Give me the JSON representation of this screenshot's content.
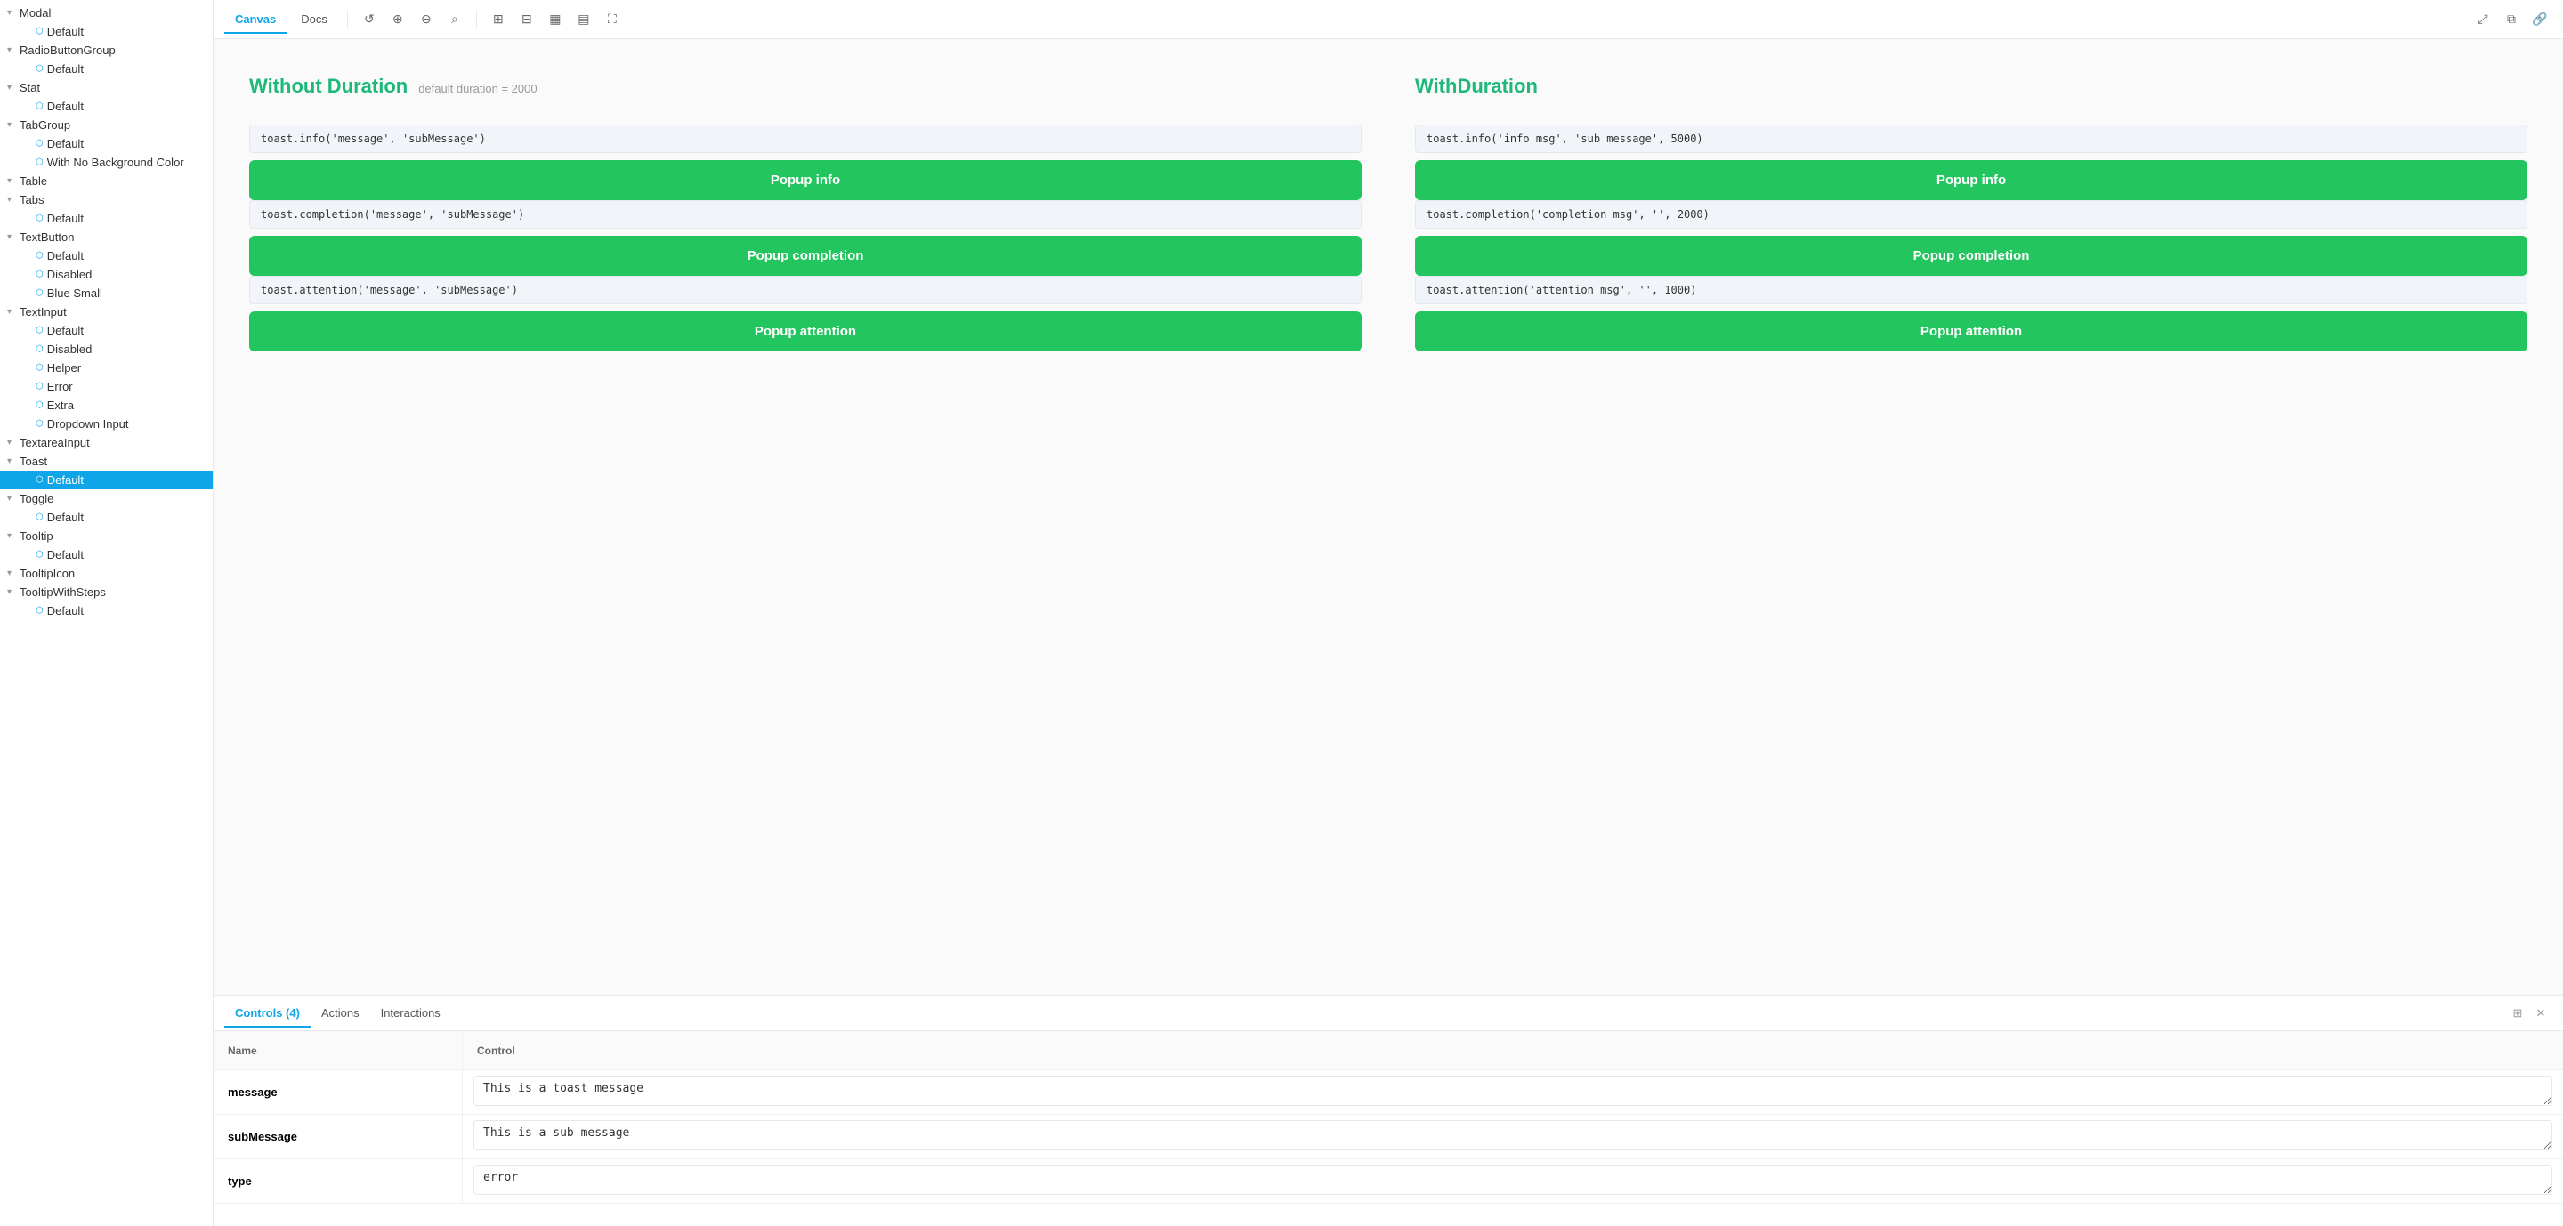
{
  "sidebar": {
    "items": [
      {
        "id": "modal",
        "label": "Modal",
        "level": 0,
        "expandable": true,
        "expanded": true
      },
      {
        "id": "modal-default",
        "label": "Default",
        "level": 1,
        "expandable": false
      },
      {
        "id": "radiobuttongroup",
        "label": "RadioButtonGroup",
        "level": 0,
        "expandable": true,
        "expanded": true
      },
      {
        "id": "radiobuttongroup-default",
        "label": "Default",
        "level": 1,
        "expandable": false
      },
      {
        "id": "stat",
        "label": "Stat",
        "level": 0,
        "expandable": true,
        "expanded": true
      },
      {
        "id": "stat-default",
        "label": "Default",
        "level": 1,
        "expandable": false
      },
      {
        "id": "tabgroup",
        "label": "TabGroup",
        "level": 0,
        "expandable": true,
        "expanded": true
      },
      {
        "id": "tabgroup-default",
        "label": "Default",
        "level": 1,
        "expandable": false
      },
      {
        "id": "tabgroup-nobg",
        "label": "With No Background Color",
        "level": 1,
        "expandable": false
      },
      {
        "id": "table",
        "label": "Table",
        "level": 0,
        "expandable": true,
        "expanded": true
      },
      {
        "id": "tabs",
        "label": "Tabs",
        "level": 0,
        "expandable": true,
        "expanded": true
      },
      {
        "id": "tabs-default",
        "label": "Default",
        "level": 1,
        "expandable": false
      },
      {
        "id": "textbutton",
        "label": "TextButton",
        "level": 0,
        "expandable": true,
        "expanded": true
      },
      {
        "id": "textbutton-default",
        "label": "Default",
        "level": 1,
        "expandable": false
      },
      {
        "id": "textbutton-disabled",
        "label": "Disabled",
        "level": 1,
        "expandable": false
      },
      {
        "id": "textbutton-bluesm",
        "label": "Blue Small",
        "level": 1,
        "expandable": false
      },
      {
        "id": "textinput",
        "label": "TextInput",
        "level": 0,
        "expandable": true,
        "expanded": true
      },
      {
        "id": "textinput-default",
        "label": "Default",
        "level": 1,
        "expandable": false
      },
      {
        "id": "textinput-disabled",
        "label": "Disabled",
        "level": 1,
        "expandable": false
      },
      {
        "id": "textinput-helper",
        "label": "Helper",
        "level": 1,
        "expandable": false
      },
      {
        "id": "textinput-error",
        "label": "Error",
        "level": 1,
        "expandable": false
      },
      {
        "id": "textinput-extra",
        "label": "Extra",
        "level": 1,
        "expandable": false
      },
      {
        "id": "textinput-dropdown",
        "label": "Dropdown Input",
        "level": 1,
        "expandable": false
      },
      {
        "id": "textareainput",
        "label": "TextareaInput",
        "level": 0,
        "expandable": true,
        "expanded": true
      },
      {
        "id": "toast",
        "label": "Toast",
        "level": 0,
        "expandable": true,
        "expanded": true,
        "selected": false
      },
      {
        "id": "toast-default",
        "label": "Default",
        "level": 1,
        "expandable": false,
        "selected": true
      },
      {
        "id": "toggle",
        "label": "Toggle",
        "level": 0,
        "expandable": true,
        "expanded": true
      },
      {
        "id": "toggle-default",
        "label": "Default",
        "level": 1,
        "expandable": false
      },
      {
        "id": "tooltip",
        "label": "Tooltip",
        "level": 0,
        "expandable": true,
        "expanded": true
      },
      {
        "id": "tooltip-default",
        "label": "Default",
        "level": 1,
        "expandable": false
      },
      {
        "id": "tooltipicon",
        "label": "TooltipIcon",
        "level": 0,
        "expandable": true,
        "expanded": true
      },
      {
        "id": "tooltipwithsteps",
        "label": "TooltipWithSteps",
        "level": 0,
        "expandable": true,
        "expanded": true
      },
      {
        "id": "tooltipwithsteps-default",
        "label": "Default",
        "level": 1,
        "expandable": false
      }
    ]
  },
  "toolbar": {
    "canvas_label": "Canvas",
    "docs_label": "Docs",
    "active_tab": "Canvas"
  },
  "canvas": {
    "left_column": {
      "title": "Without Duration",
      "subtitle": "default duration = 2000",
      "blocks": [
        {
          "code": "toast.info('message', 'subMessage')",
          "button": "Popup info"
        },
        {
          "code": "toast.completion('message', 'subMessage')",
          "button": "Popup completion"
        },
        {
          "code": "toast.attention('message', 'subMessage')",
          "button": "Popup attention"
        }
      ]
    },
    "right_column": {
      "title": "WithDuration",
      "subtitle": "",
      "blocks": [
        {
          "code": "toast.info('info msg', 'sub message', 5000)",
          "button": "Popup info"
        },
        {
          "code": "toast.completion('completion msg', '', 2000)",
          "button": "Popup completion"
        },
        {
          "code": "toast.attention('attention msg', '', 1000)",
          "button": "Popup attention"
        }
      ]
    }
  },
  "bottom_panel": {
    "tabs": [
      {
        "label": "Controls (4)",
        "id": "controls",
        "active": true
      },
      {
        "label": "Actions",
        "id": "actions",
        "active": false
      },
      {
        "label": "Interactions",
        "id": "interactions",
        "active": false
      }
    ],
    "controls_header": {
      "name_col": "Name",
      "control_col": "Control"
    },
    "controls": [
      {
        "name": "message",
        "value": "This is a toast message",
        "type": "textarea"
      },
      {
        "name": "subMessage",
        "value": "This is a sub message",
        "type": "textarea"
      },
      {
        "name": "type",
        "value": "error",
        "type": "textarea"
      }
    ]
  }
}
